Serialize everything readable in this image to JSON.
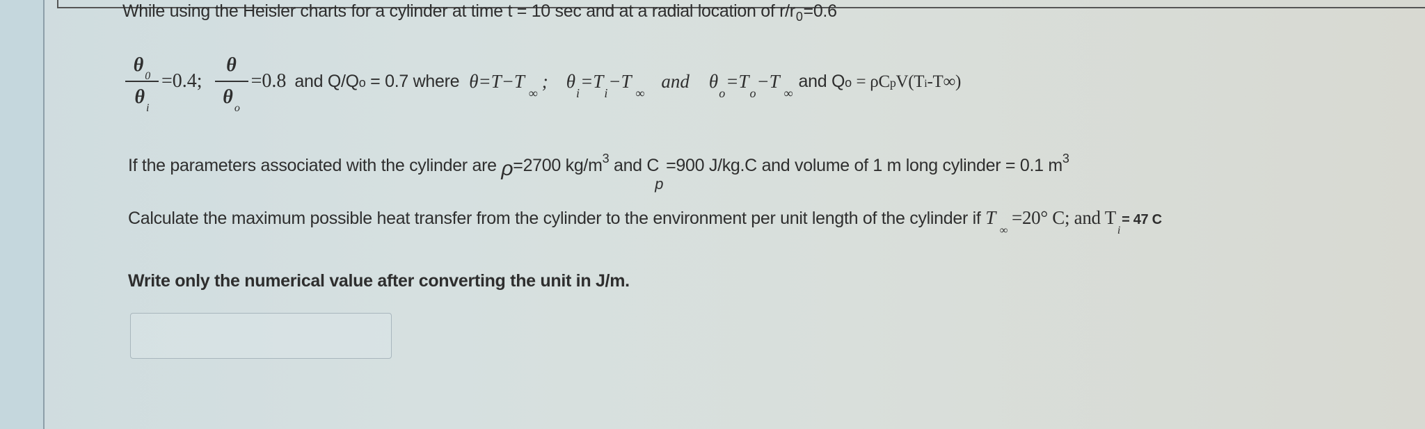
{
  "question": {
    "line1": "While using the Heisler charts for a cylinder at time t = 10 sec and at a radial location of r/r",
    "line1_sub": "0",
    "line1_end": "=0.6",
    "ratios": {
      "frac1_num": "θ",
      "frac1_num_sub": "0",
      "frac1_den": "θ",
      "frac1_den_sub": "i",
      "frac1_value": "=0.4;",
      "frac2_num": "θ",
      "frac2_den": "θ",
      "frac2_den_sub": "o",
      "frac2_value": "=0.8",
      "and_q": "and Q/Q",
      "q_sub": "o",
      "q_value": "= 0.7 where",
      "def1": "θ=T−T",
      "def1_sub": "∞",
      "def1_end": ";",
      "def2_a": "θ",
      "def2_a_sub": "i",
      "def2_b": "=T",
      "def2_b_sub": "i",
      "def2_c": "−T",
      "def2_c_sub": "∞",
      "and_word": "and",
      "def3_a": "θ",
      "def3_a_sub": "o",
      "def3_b": "=T",
      "def3_b_sub": "o",
      "def3_c": "−T",
      "def3_c_sub": "∞",
      "q0_def": "and Q",
      "q0_sub": "o",
      "q0_eq": "= ρC",
      "q0_cp_sub": "p",
      "q0_rest": "V(T",
      "q0_ti_sub": "i",
      "q0_tail": "-T∞)"
    },
    "params_text": "If the parameters associated with the cylinder are ",
    "rho_symbol": "ρ",
    "rho_value": "=2700 kg/m",
    "rho_exp": "3",
    "and_cp": " and C",
    "cp_sub": "p",
    "cp_value": "=900 J/kg.C and volume of 1 m long cylinder = 0.1 m",
    "vol_exp": "3",
    "calc_text": "Calculate the maximum possible heat transfer from the cylinder to the environment per unit length of the cylinder if ",
    "t_inf": "T",
    "t_inf_sub": "∞",
    "t_inf_value": "=20° C; and T",
    "ti_sub": "i",
    "ti_value": "= 47 C",
    "instruction": "Write only the numerical value after converting the unit in J/m."
  },
  "answer": {
    "value": "",
    "placeholder": ""
  }
}
